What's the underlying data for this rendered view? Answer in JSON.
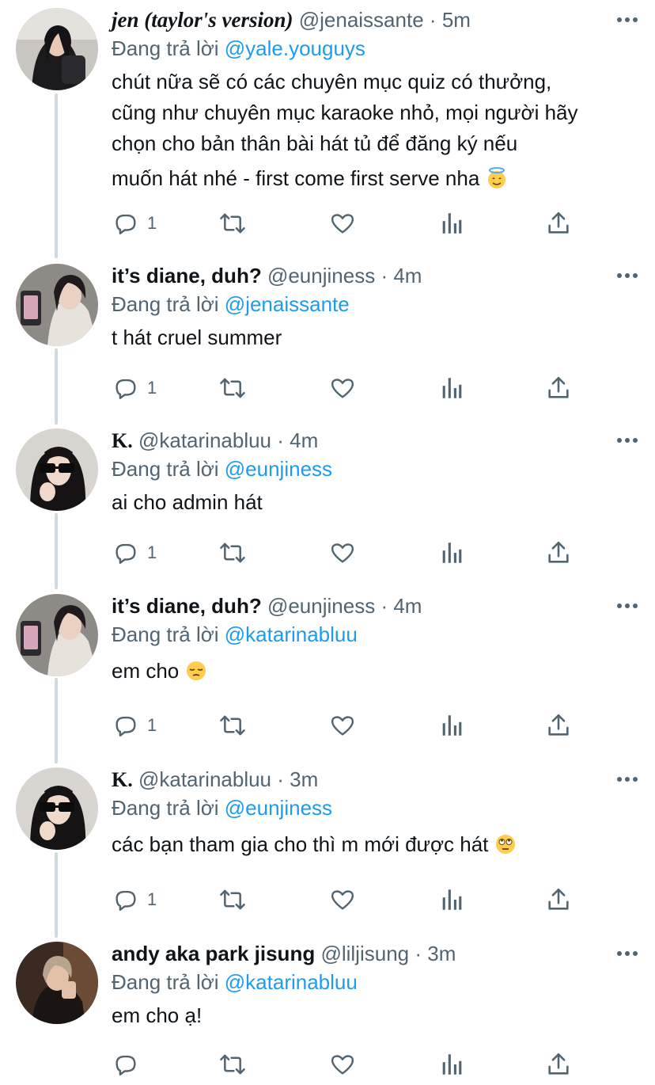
{
  "tweets": [
    {
      "name": "jen (taylor's version)",
      "handle": "@jenaissante",
      "sep": "·",
      "time": "5m",
      "reply_prefix": "Đang trả lời ",
      "reply_to": "@yale.youguys",
      "lines": [
        "chút nữa sẽ có các chuyên mục quiz có thưởng,",
        "cũng như chuyên mục karaoke nhỏ, mọi người hãy",
        "chọn cho bản thân bài hát tủ để đăng ký nếu",
        "muốn hát nhé - first come first serve nha"
      ],
      "emoji": "halo-face-emoji",
      "reply_count": "1"
    },
    {
      "name": "it’s diane, duh?",
      "handle": "@eunjiness",
      "sep": "·",
      "time": "4m",
      "reply_prefix": "Đang trả lời ",
      "reply_to": "@jenaissante",
      "lines": [
        "t hát cruel summer"
      ],
      "reply_count": "1"
    },
    {
      "name": "K.",
      "handle": "@katarinabluu",
      "sep": "·",
      "time": "4m",
      "reply_prefix": "Đang trả lời ",
      "reply_to": "@eunjiness",
      "lines": [
        "ai cho admin hát"
      ],
      "reply_count": "1"
    },
    {
      "name": "it’s diane, duh?",
      "handle": "@eunjiness",
      "sep": "·",
      "time": "4m",
      "reply_prefix": "Đang trả lời ",
      "reply_to": "@katarinabluu",
      "lines": [
        "em cho"
      ],
      "emoji": "unamused-face-emoji",
      "reply_count": "1"
    },
    {
      "name": "K.",
      "handle": "@katarinabluu",
      "sep": "·",
      "time": "3m",
      "reply_prefix": "Đang trả lời ",
      "reply_to": "@eunjiness",
      "lines": [
        "các bạn tham gia cho thì m mới được hát"
      ],
      "emoji": "eye-roll-face-emoji",
      "reply_count": "1"
    },
    {
      "name": "andy aka park jisung",
      "handle": "@liljisung",
      "sep": "·",
      "time": "3m",
      "reply_prefix": "Đang trả lời ",
      "reply_to": "@katarinabluu",
      "lines": [
        "em cho ạ!"
      ],
      "reply_count": ""
    }
  ],
  "colors": {
    "text": "#0f1419",
    "secondary": "#536471",
    "link": "#1d9bf0",
    "thread_line": "#cfd9de"
  }
}
